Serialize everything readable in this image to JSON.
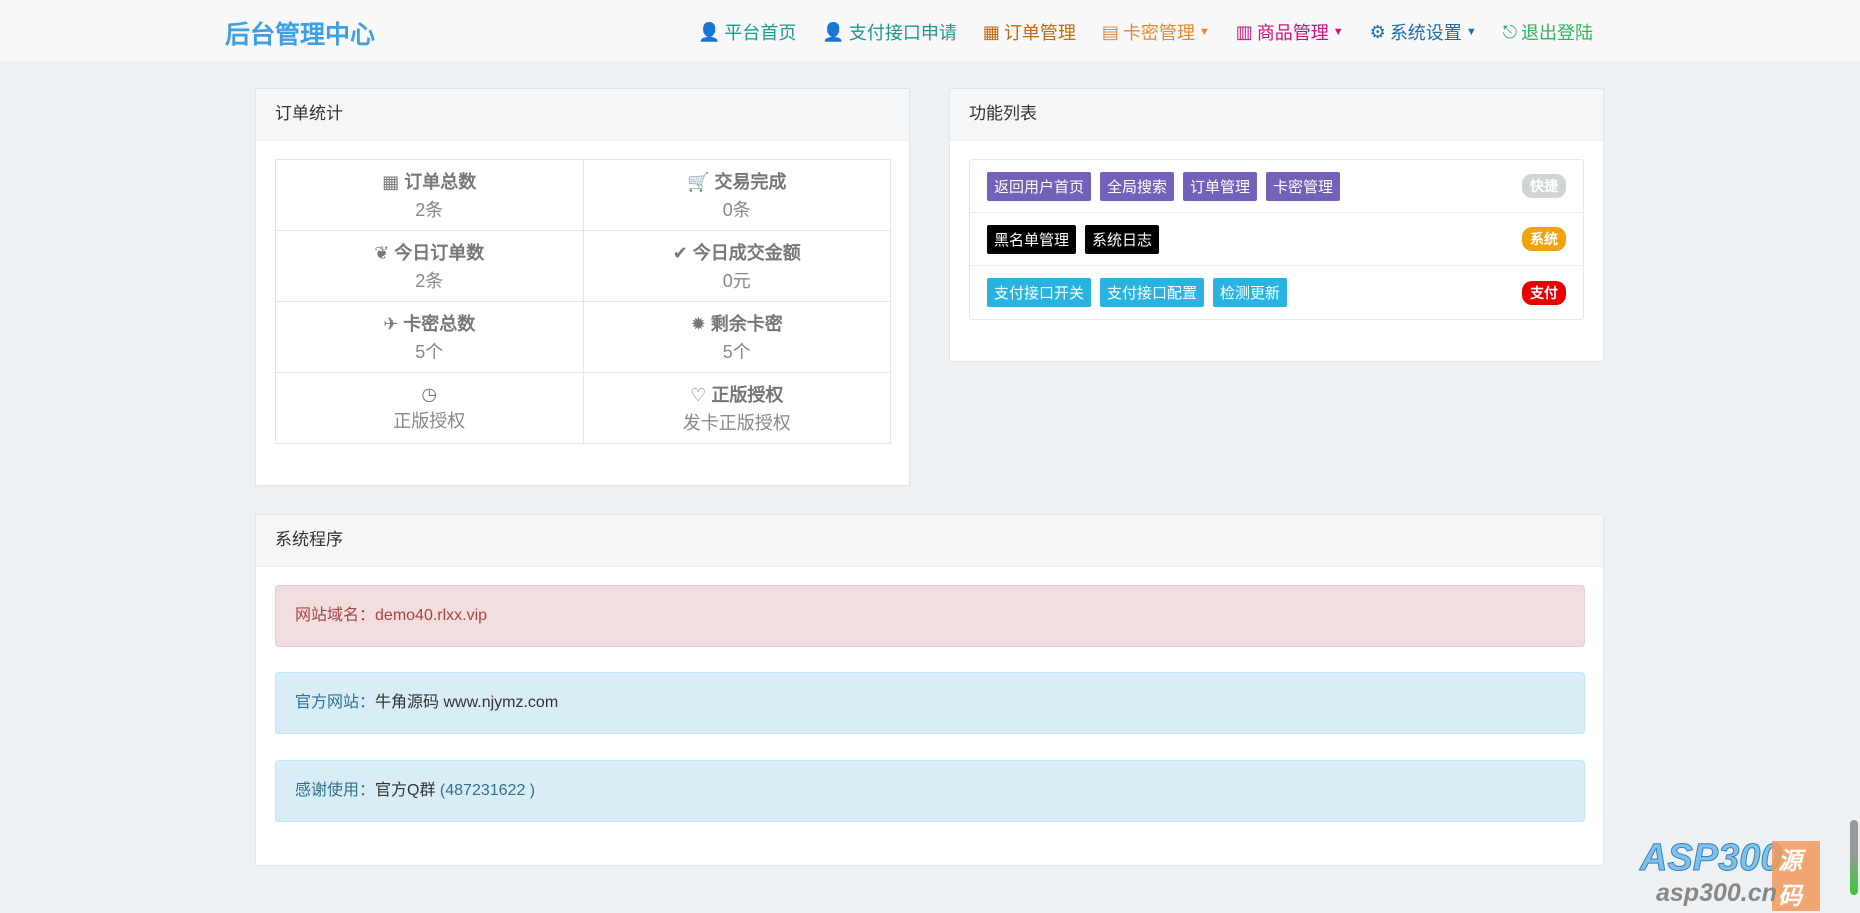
{
  "navbar": {
    "brand": "后台管理中心",
    "items": [
      {
        "label": "平台首页",
        "icon": "user-icon",
        "color": "#1a9a8f",
        "caret": false
      },
      {
        "label": "支付接口申请",
        "icon": "user-icon",
        "color": "#1a9a8f",
        "caret": false
      },
      {
        "label": "订单管理",
        "icon": "calendar-icon",
        "color": "#c46a0b",
        "caret": false
      },
      {
        "label": "卡密管理",
        "icon": "list-icon",
        "color": "#e68a2e",
        "caret": true
      },
      {
        "label": "商品管理",
        "icon": "list-alt-icon",
        "color": "#d0107e",
        "caret": true
      },
      {
        "label": "系统设置",
        "icon": "gear-icon",
        "color": "#1a6fb3",
        "caret": true
      },
      {
        "label": "退出登陆",
        "icon": "sign-out-icon",
        "color": "#2db55d",
        "caret": false
      }
    ]
  },
  "stats": {
    "title": "订单统计",
    "cells": [
      {
        "icon": "th-icon",
        "glyph": "▦",
        "label": "订单总数",
        "value": "2条"
      },
      {
        "icon": "cart-icon",
        "glyph": "🛒",
        "label": "交易完成",
        "value": "0条"
      },
      {
        "icon": "leaf-icon",
        "glyph": "❦",
        "label": "今日订单数",
        "value": "2条"
      },
      {
        "icon": "check-icon",
        "glyph": "✔",
        "label": "今日成交金额",
        "value": "0元"
      },
      {
        "icon": "plane-icon",
        "glyph": "✈",
        "label": "卡密总数",
        "value": "5个"
      },
      {
        "icon": "certificate-icon",
        "glyph": "✹",
        "label": "剩余卡密",
        "value": "5个"
      },
      {
        "icon": "dashboard-icon",
        "glyph": "◷",
        "label": "",
        "value": "正版授权"
      },
      {
        "icon": "heart-icon",
        "glyph": "♡",
        "label": "正版授权",
        "value": "发卡正版授权"
      }
    ]
  },
  "functions": {
    "title": "功能列表",
    "rows": [
      {
        "badge": "快捷",
        "badge_color": "#d0d5d8",
        "btn_color": "#7460b8",
        "buttons": [
          "返回用户首页",
          "全局搜索",
          "订单管理",
          "卡密管理"
        ]
      },
      {
        "badge": "系统",
        "badge_color": "#f0a30a",
        "btn_color": "#000000",
        "buttons": [
          "黑名单管理",
          "系统日志"
        ]
      },
      {
        "badge": "支付",
        "badge_color": "#e60000",
        "btn_color": "#29b3e0",
        "buttons": [
          "支付接口开关",
          "支付接口配置",
          "检测更新"
        ]
      }
    ]
  },
  "system": {
    "title": "系统程序",
    "domain_label": "网站域名：",
    "domain": "demo40.rlxx.vip",
    "site_label": "官方网站：",
    "site": "牛角源码 www.njymz.com",
    "thanks_label": "感谢使用：",
    "thanks_group": "官方Q群",
    "thanks_qq": "(487231622 )"
  },
  "watermark": {
    "logo": "ASP300",
    "tag": "源码",
    "url": "asp300.cn"
  }
}
